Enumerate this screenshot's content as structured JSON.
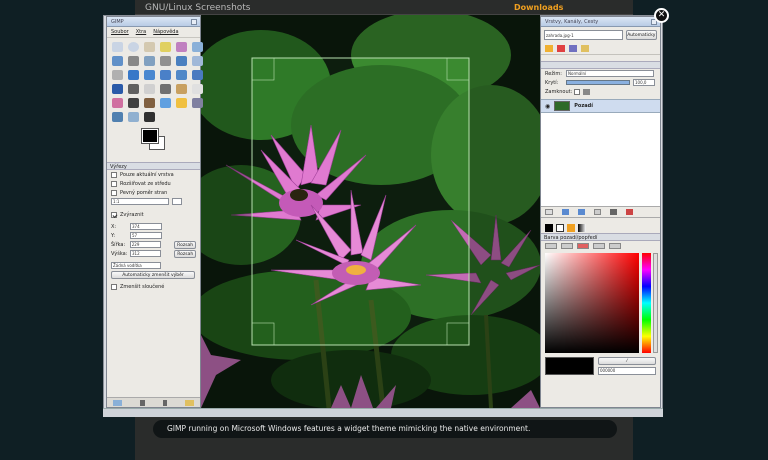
{
  "page": {
    "title": "GNU/Linux Screenshots",
    "downloads": "Downloads",
    "caption": "GIMP running on Microsoft Windows features a widget theme mimicking the native environment."
  },
  "toolbox": {
    "title": "GIMP",
    "menu": [
      "Soubor",
      "Xtra",
      "Nápověda"
    ],
    "options_title": "Výřezy",
    "options": {
      "opt1": "Pouze aktuální vrstva",
      "opt2": "Rozšiřovat ze středu",
      "opt3": "Pevný poměr stran",
      "ratio": "1:1",
      "zoom_label": "Zvýraznit",
      "x_label": "X:",
      "x_value": "374",
      "y_label": "Y:",
      "y_value": "57",
      "w_label": "Šířka:",
      "w_value": "229",
      "h_label": "Výška:",
      "h_value": "312",
      "px1": "Rozsah",
      "px2": "Rozsah",
      "guides": "Žádná vodítka",
      "auto_button": "Automaticky zmenšit výběr",
      "last_opt": "Zmenšit sloučené"
    }
  },
  "layers": {
    "title": "Vrstvy, Kanály, Cesty",
    "image_select": "zahrada.jpg-1",
    "auto_button": "Automaticky",
    "mode_label": "Režim:",
    "mode_value": "Normální",
    "opacity_label": "Krytí:",
    "opacity_value": "100,0",
    "lock_label": "Zamknout:",
    "layer_name": "Pozadí"
  },
  "colors": {
    "title": "Barva pozadí/popředí",
    "hex_value": "000000"
  },
  "icons": {
    "close": "close-icon",
    "eye": "eye-icon"
  },
  "accent": "#f0a020"
}
